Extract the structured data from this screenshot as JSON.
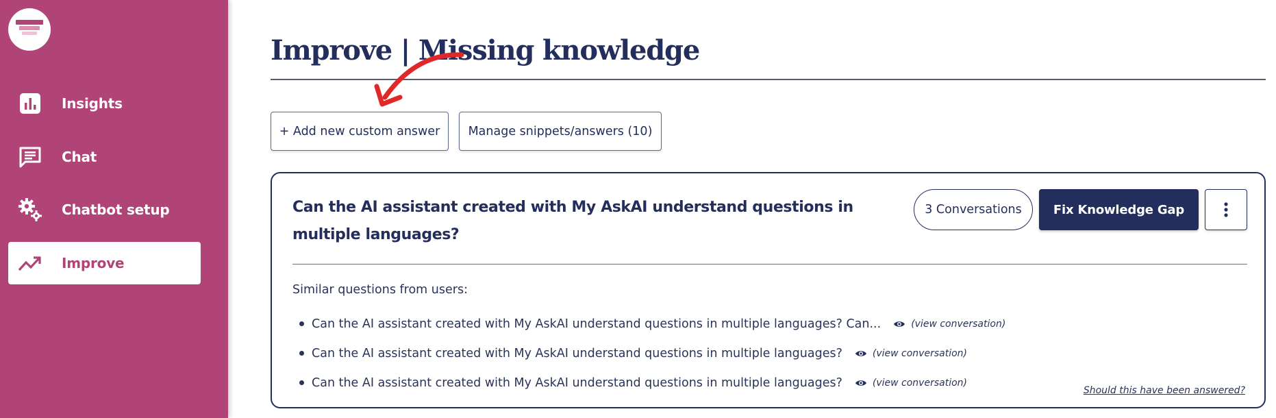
{
  "colors": {
    "sidebar_bg": "#b04477",
    "navy": "#232e5c",
    "annotation_arrow": "#e02828"
  },
  "sidebar": {
    "logo_icon": "layered-stack-logo",
    "items": [
      {
        "label": "Insights",
        "icon": "bar-chart-icon",
        "active": false
      },
      {
        "label": "Chat",
        "icon": "chat-bubble-icon",
        "active": false
      },
      {
        "label": "Chatbot setup",
        "icon": "gears-icon",
        "active": false
      },
      {
        "label": "Improve",
        "icon": "trending-up-icon",
        "active": true
      }
    ]
  },
  "page": {
    "title": "Improve | Missing knowledge"
  },
  "actions": {
    "add_label": "+ Add new custom answer",
    "manage_label": "Manage snippets/answers (10)"
  },
  "card": {
    "question": "Can the AI assistant created with My AskAI understand questions in multiple languages?",
    "conversations_label": "3 Conversations",
    "fix_label": "Fix Knowledge Gap",
    "more_icon": "vertical-dots-icon",
    "similar_label": "Similar questions from users:",
    "similar_questions": [
      {
        "text": "Can the AI assistant created with My AskAI understand questions in multiple languages? Can...",
        "link": "(view conversation)"
      },
      {
        "text": "Can the AI assistant created with My AskAI understand questions in multiple languages?",
        "link": "(view conversation)"
      },
      {
        "text": "Can the AI assistant created with My AskAI understand questions in multiple languages?",
        "link": "(view conversation)"
      }
    ],
    "answered_link": "Should this have been answered?"
  }
}
